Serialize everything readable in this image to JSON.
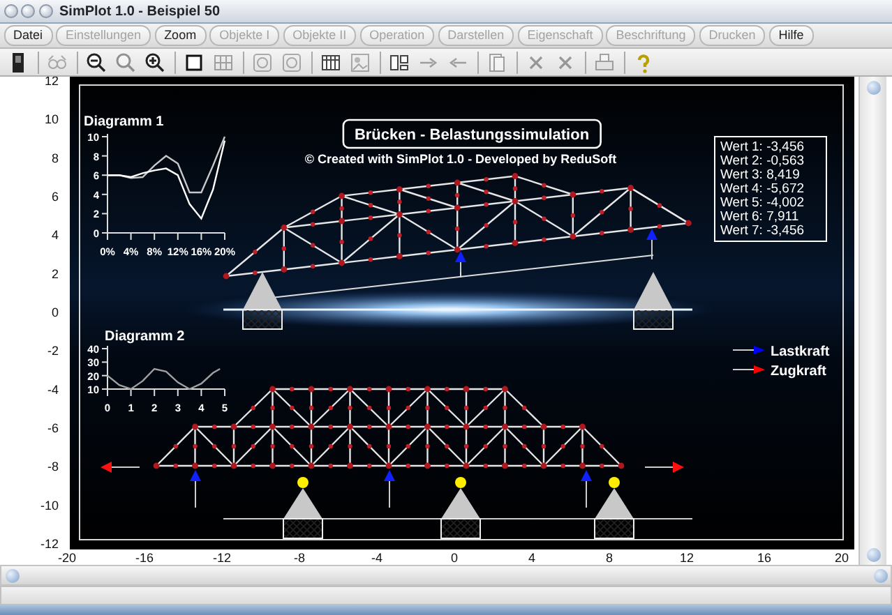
{
  "window": {
    "title": "SimPlot 1.0 - Beispiel 50"
  },
  "menu": [
    {
      "label": "Datei",
      "disabled": false
    },
    {
      "label": "Einstellungen",
      "disabled": true
    },
    {
      "label": "Zoom",
      "disabled": false
    },
    {
      "label": "Objekte I",
      "disabled": true
    },
    {
      "label": "Objekte II",
      "disabled": true
    },
    {
      "label": "Operation",
      "disabled": true
    },
    {
      "label": "Darstellen",
      "disabled": true
    },
    {
      "label": "Eigenschaft",
      "disabled": true
    },
    {
      "label": "Beschriftung",
      "disabled": true
    },
    {
      "label": "Drucken",
      "disabled": true
    },
    {
      "label": "Hilfe",
      "disabled": false
    }
  ],
  "toolbar": [
    {
      "kind": "device",
      "disabled": false
    },
    {
      "kind": "separator"
    },
    {
      "kind": "glasses",
      "disabled": true
    },
    {
      "kind": "separator"
    },
    {
      "kind": "zoomout",
      "disabled": false
    },
    {
      "kind": "zoom",
      "disabled": true
    },
    {
      "kind": "zoomin",
      "disabled": false
    },
    {
      "kind": "separator"
    },
    {
      "kind": "square",
      "disabled": false
    },
    {
      "kind": "grid",
      "disabled": true
    },
    {
      "kind": "separator"
    },
    {
      "kind": "ring",
      "disabled": true
    },
    {
      "kind": "ring",
      "disabled": true
    },
    {
      "kind": "separator"
    },
    {
      "kind": "table",
      "disabled": false
    },
    {
      "kind": "picture",
      "disabled": true
    },
    {
      "kind": "separator"
    },
    {
      "kind": "layout",
      "disabled": false
    },
    {
      "kind": "right",
      "disabled": true
    },
    {
      "kind": "left",
      "disabled": true
    },
    {
      "kind": "separator"
    },
    {
      "kind": "document",
      "disabled": true
    },
    {
      "kind": "separator"
    },
    {
      "kind": "cross",
      "disabled": true
    },
    {
      "kind": "cross",
      "disabled": true
    },
    {
      "kind": "separator"
    },
    {
      "kind": "printer",
      "disabled": true
    },
    {
      "kind": "separator"
    },
    {
      "kind": "help",
      "disabled": false
    }
  ],
  "plot": {
    "xticks": [
      "-20",
      "-16",
      "-12",
      "-8",
      "-4",
      "0",
      "4",
      "8",
      "12",
      "16",
      "20"
    ],
    "yticks": [
      "12",
      "10",
      "8",
      "6",
      "4",
      "2",
      "0",
      "-2",
      "-4",
      "-6",
      "-8",
      "-10",
      "-12"
    ],
    "title": "Brücken - Belastungssimulation",
    "credit": "© Created with SimPlot 1.0 - Developed by ReduSoft",
    "values": [
      "Wert 1: -3,456",
      "Wert 2: -0,563",
      "Wert 3: 8,419",
      "Wert 4: -5,672",
      "Wert 5: -4,002",
      "Wert 6: 7,911",
      "Wert 7: -3,456"
    ],
    "legend": [
      {
        "label": "Lastkraft",
        "color": "#0000ff"
      },
      {
        "label": "Zugkraft",
        "color": "#ff0000"
      }
    ],
    "diagrams": [
      {
        "chart_data": {
          "type": "line",
          "title": "Diagramm 1",
          "x": [
            0,
            2,
            4,
            6,
            8,
            10,
            12,
            14,
            16,
            18,
            20
          ],
          "series": [
            {
              "color": "#c8c8c8",
              "values": [
                6,
                6,
                5.7,
                5.8,
                7,
                8,
                7.2,
                4.2,
                4.2,
                7,
                10
              ]
            },
            {
              "color": "#ffffff",
              "values": [
                6,
                6,
                5.8,
                6.2,
                6.5,
                6.7,
                6,
                3,
                1.5,
                4.5,
                9.6
              ]
            }
          ],
          "xlim": [
            0,
            20
          ],
          "ylim": [
            0,
            10
          ],
          "xticks": [
            {
              "value": 0,
              "label": "0%"
            },
            {
              "value": 4,
              "label": "4%"
            },
            {
              "value": 8,
              "label": "8%"
            },
            {
              "value": 12,
              "label": "12%"
            },
            {
              "value": 16,
              "label": "16%"
            },
            {
              "value": 20,
              "label": "20%"
            }
          ],
          "yticks": [
            0,
            2,
            4,
            6,
            8,
            10
          ]
        }
      },
      {
        "chart_data": {
          "type": "line",
          "title": "Diagramm 2",
          "x": [
            0,
            0.5,
            1,
            1.5,
            2,
            2.5,
            3,
            3.5,
            4,
            4.5,
            4.8
          ],
          "series": [
            {
              "color": "#a0a0a0",
              "values": [
                20,
                13,
                10,
                16,
                25,
                23,
                15,
                10,
                14,
                22,
                25
              ]
            }
          ],
          "xlim": [
            0,
            5
          ],
          "ylim": [
            10,
            40
          ],
          "xticks": [
            0,
            1,
            2,
            3,
            4,
            5
          ],
          "yticks": [
            10,
            20,
            30,
            40
          ]
        }
      }
    ]
  }
}
